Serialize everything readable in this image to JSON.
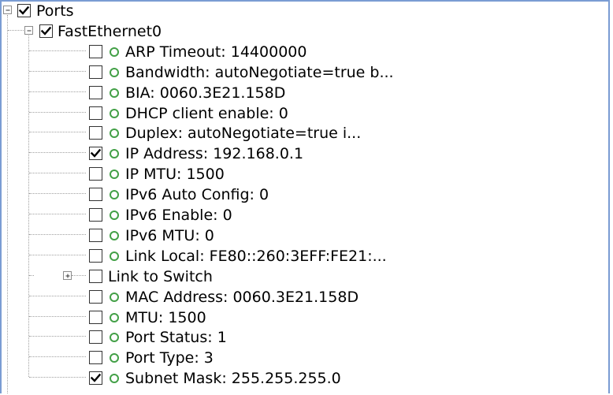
{
  "tree": {
    "root": {
      "label": "Ports",
      "checked": true,
      "expanded": true,
      "children": [
        {
          "label": "FastEthernet0",
          "checked": true,
          "expanded": true,
          "children": [
            {
              "label": "ARP Timeout: 14400000",
              "checked": false,
              "icon": "status-dot-icon"
            },
            {
              "label": "Bandwidth: autoNegotiate=true b...",
              "checked": false,
              "icon": "status-dot-icon"
            },
            {
              "label": "BIA: 0060.3E21.158D",
              "checked": false,
              "icon": "status-dot-icon"
            },
            {
              "label": "DHCP client enable: 0",
              "checked": false,
              "icon": "status-dot-icon"
            },
            {
              "label": "Duplex: autoNegotiate=true i...",
              "checked": false,
              "icon": "status-dot-icon"
            },
            {
              "label": "IP Address: 192.168.0.1",
              "checked": true,
              "icon": "status-dot-icon"
            },
            {
              "label": "IP MTU: 1500",
              "checked": false,
              "icon": "status-dot-icon"
            },
            {
              "label": "IPv6 Auto Config: 0",
              "checked": false,
              "icon": "status-dot-icon"
            },
            {
              "label": "IPv6 Enable: 0",
              "checked": false,
              "icon": "status-dot-icon"
            },
            {
              "label": "IPv6 MTU: 0",
              "checked": false,
              "icon": "status-dot-icon"
            },
            {
              "label": "Link Local: FE80::260:3EFF:FE21:...",
              "checked": false,
              "icon": "status-dot-icon"
            },
            {
              "label": "Link to Switch",
              "checked": false,
              "expandable": true,
              "expanded": false
            },
            {
              "label": "MAC Address: 0060.3E21.158D",
              "checked": false,
              "icon": "status-dot-icon"
            },
            {
              "label": "MTU: 1500",
              "checked": false,
              "icon": "status-dot-icon"
            },
            {
              "label": "Port Status: 1",
              "checked": false,
              "icon": "status-dot-icon"
            },
            {
              "label": "Port Type: 3",
              "checked": false,
              "icon": "status-dot-icon"
            },
            {
              "label": "Subnet Mask: 255.255.255.0",
              "checked": true,
              "icon": "status-dot-icon"
            }
          ]
        }
      ]
    }
  },
  "colors": {
    "frame_border": "#7a9cd3",
    "status_dot": "#43a047",
    "tree_lines": "#a0a0a0"
  }
}
